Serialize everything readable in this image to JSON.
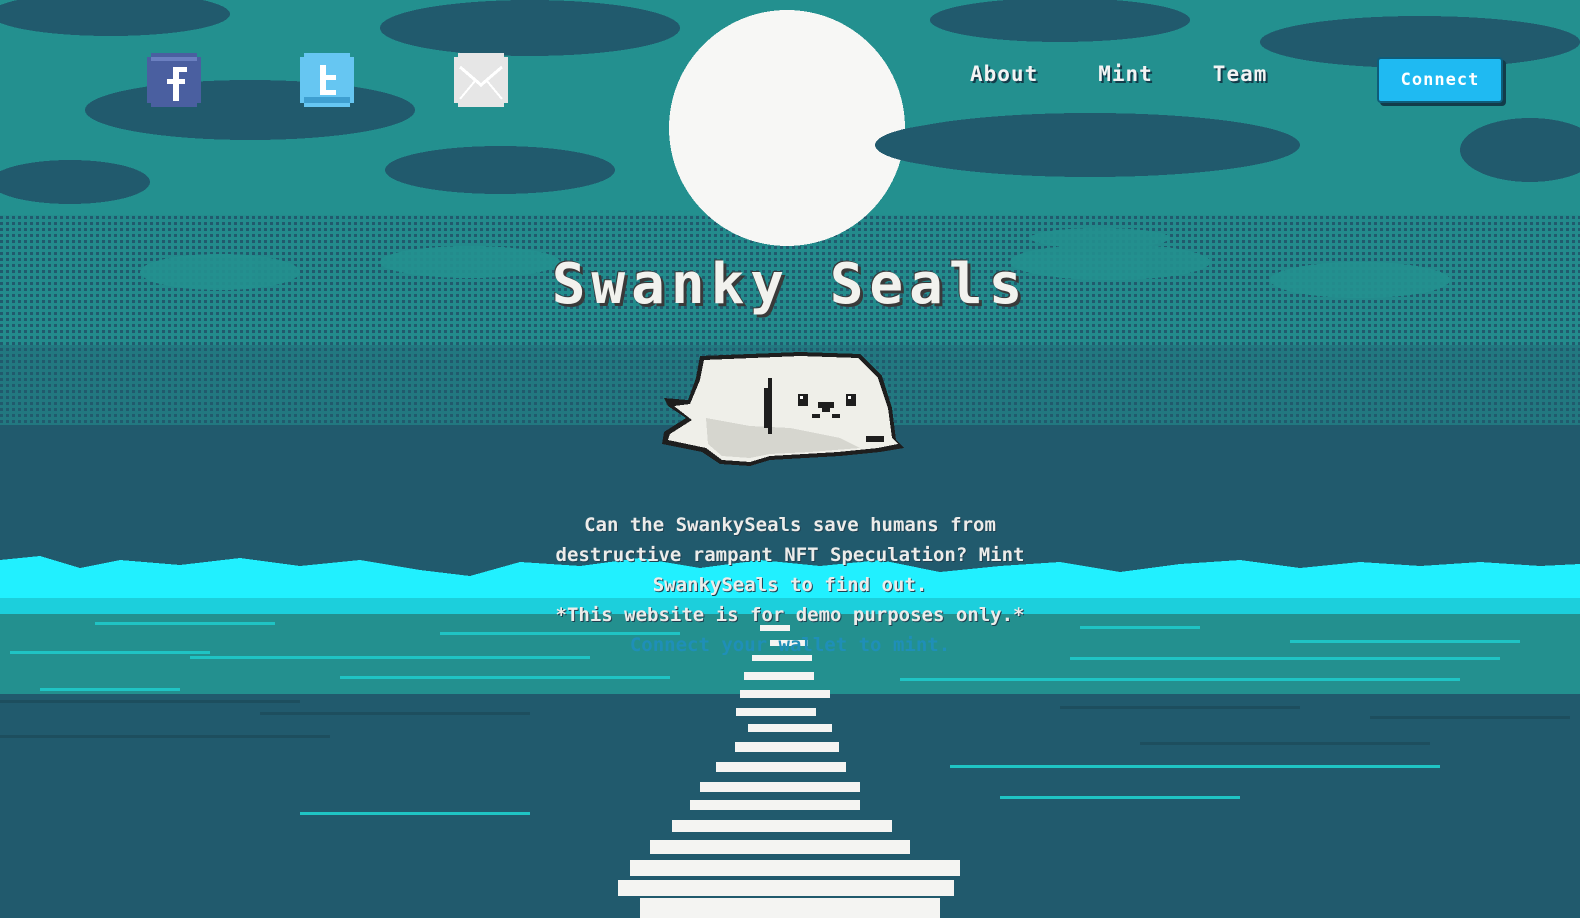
{
  "page": {
    "title": "Swanky Seals",
    "description": "Can the SwankySeals save humans from destructive rampant NFT Speculation? Mint SwankySeals to find out.",
    "disclaimer": "*This website is for demo purposes only.*",
    "wallet_prompt": "Connect your wallet to mint."
  },
  "social": [
    {
      "name": "facebook",
      "icon": "facebook-icon",
      "glyph": "f",
      "color": "#4a5fa0"
    },
    {
      "name": "twitter",
      "icon": "twitter-icon",
      "glyph": "t",
      "color": "#66c6f2"
    },
    {
      "name": "email",
      "icon": "mail-icon",
      "color": "#e6e6e6"
    }
  ],
  "nav": {
    "links": [
      "About",
      "Mint",
      "Team"
    ],
    "connect_label": "Connect"
  },
  "colors": {
    "sky": "#23908f",
    "cloud": "#215a6d",
    "moon": "#f7f7f5",
    "wave": "#21f0ff",
    "accent": "#1fbaf2"
  }
}
